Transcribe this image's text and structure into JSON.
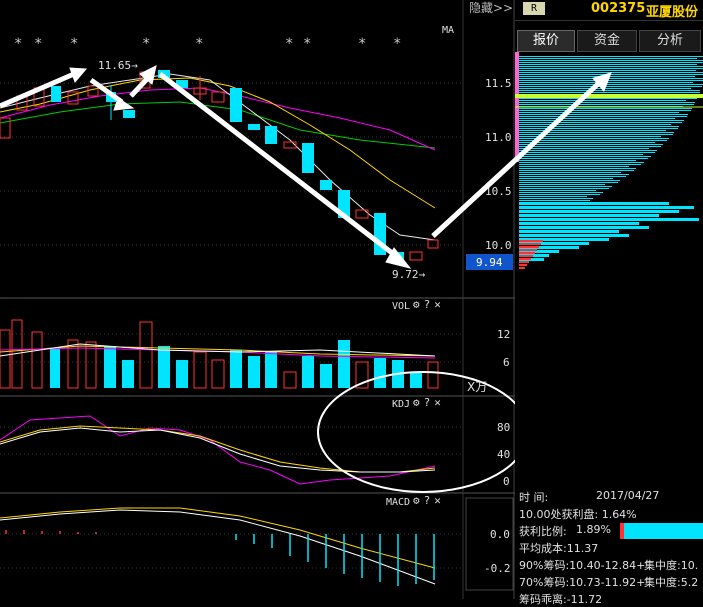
{
  "toolbar": {
    "hide_label": "隐藏>>"
  },
  "stock": {
    "badge": "R",
    "code": "002375",
    "name": "亚厦股份"
  },
  "tabs": [
    "报价",
    "资金",
    "分析"
  ],
  "main_chart": {
    "ma_label": "MA",
    "y_ticks": [
      "11.5",
      "11.0",
      "10.5",
      "10.0"
    ],
    "high_label": "11.65→",
    "low_label": "9.72→",
    "current_price": "9.94"
  },
  "vol_panel": {
    "label": "VOL",
    "y_ticks": [
      "12",
      "6"
    ],
    "unit": "X万"
  },
  "kdj_panel": {
    "label": "KDJ",
    "y_ticks": [
      "80",
      "40",
      "0"
    ]
  },
  "macd_panel": {
    "label": "MACD",
    "y_ticks": [
      "0.0",
      "-0.2"
    ]
  },
  "panel_icons": {
    "gear": "⚙",
    "help": "?",
    "close": "✕"
  },
  "chip_info": {
    "date_label": "时      间:",
    "date_value": "2017/04/27",
    "profit_at": "10.00处获利盘: 1.64%",
    "profit_ratio_label": "获利比例:",
    "profit_ratio_value": "1.89%",
    "avg_cost": "平均成本:11.37",
    "chip90": "90%筹码:10.40-12.84+",
    "chip90_conc": "集中度:10.",
    "chip70": "70%筹码:10.73-11.92+",
    "chip70_conc": "集中度:5.2",
    "cut_line": "筹码乖离:-11.72"
  },
  "colors": {
    "up": "#ff3333",
    "down": "#00e5ff",
    "accent_yellow": "#ffd700",
    "ma_green": "#00cc00",
    "ma_magenta": "#ff00ff"
  }
}
